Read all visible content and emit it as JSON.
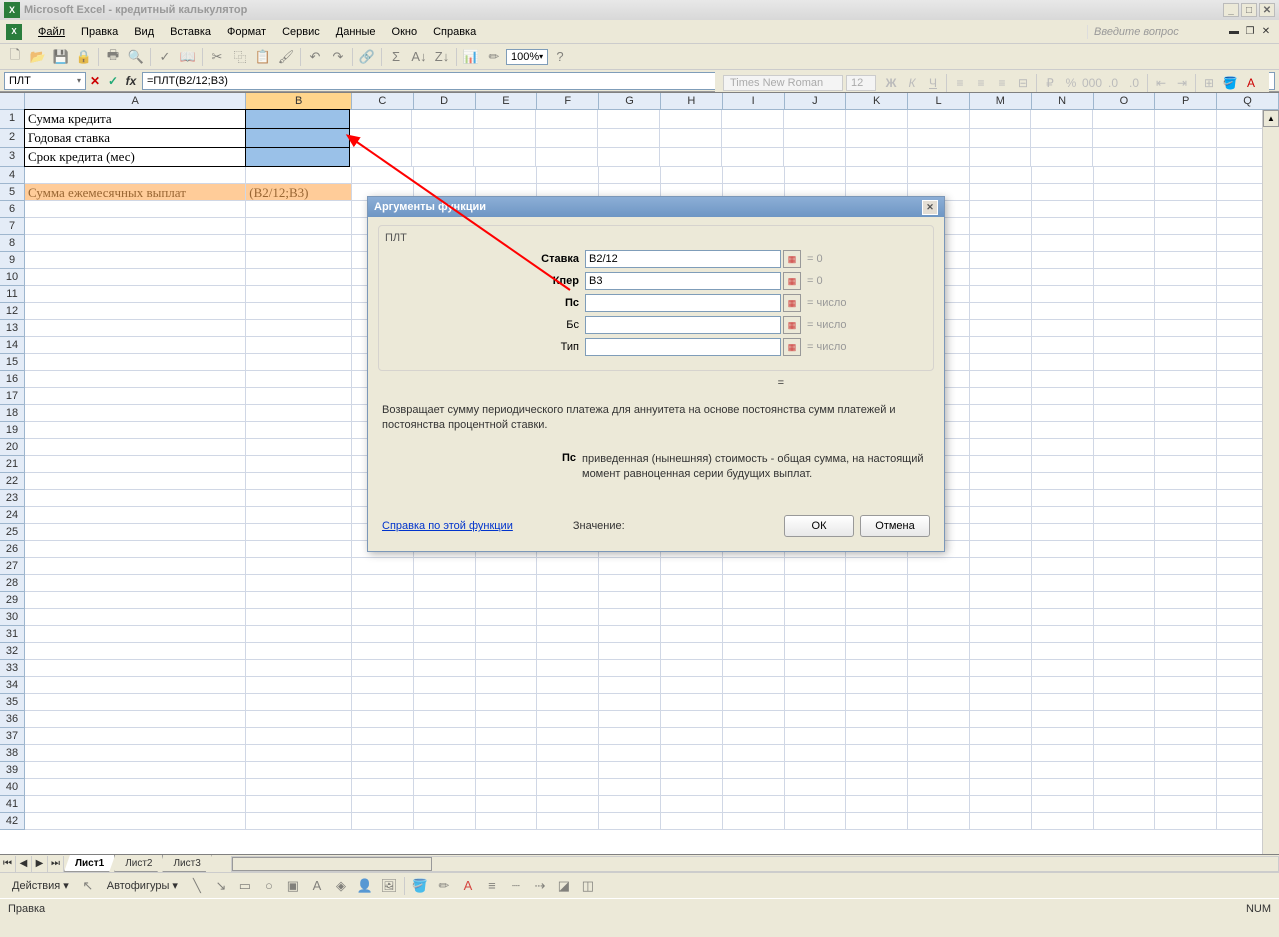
{
  "title": "Microsoft Excel - кредитный калькулятор",
  "menus": {
    "file": "Файл",
    "edit": "Правка",
    "view": "Вид",
    "insert": "Вставка",
    "format": "Формат",
    "tools": "Сервис",
    "data": "Данные",
    "window": "Окно",
    "help": "Справка"
  },
  "help_prompt": "Введите вопрос",
  "zoom": "100%",
  "font_name": "Times New Roman",
  "font_size": "12",
  "name_box": "ПЛТ",
  "formula": "=ПЛТ(B2/12;B3)",
  "columns": [
    "A",
    "B",
    "C",
    "D",
    "E",
    "F",
    "G",
    "H",
    "I",
    "J",
    "K",
    "L",
    "M",
    "N",
    "O",
    "P",
    "Q"
  ],
  "row_count": 42,
  "cells": {
    "A1": "Сумма кредита",
    "A2": "Годовая ставка",
    "A3": "Срок кредита (мес)",
    "A5": "Сумма ежемесячных выплат",
    "B5": "(B2/12;B3)"
  },
  "dialog": {
    "title": "Аргументы функции",
    "func": "ПЛТ",
    "args": [
      {
        "label": "Ставка",
        "value": "B2/12",
        "result": "= 0",
        "bold": true
      },
      {
        "label": "Кпер",
        "value": "B3",
        "result": "= 0",
        "bold": true
      },
      {
        "label": "Пс",
        "value": "",
        "result": "= число",
        "bold": true
      },
      {
        "label": "Бс",
        "value": "",
        "result": "= число",
        "bold": false
      },
      {
        "label": "Тип",
        "value": "",
        "result": "= число",
        "bold": false
      }
    ],
    "eq": "=",
    "desc": "Возвращает сумму периодического платежа для аннуитета на основе постоянства сумм платежей и постоянства процентной ставки.",
    "param_name": "Пс",
    "param_desc": "приведенная (нынешняя) стоимость - общая сумма, на настоящий момент равноценная серии будущих выплат.",
    "help_link": "Справка по этой функции",
    "value_label": "Значение:",
    "ok": "ОК",
    "cancel": "Отмена"
  },
  "tabs": {
    "sheet1": "Лист1",
    "sheet2": "Лист2",
    "sheet3": "Лист3"
  },
  "draw": {
    "actions": "Действия",
    "autoshapes": "Автофигуры"
  },
  "status": {
    "left": "Правка",
    "right": "NUM"
  }
}
